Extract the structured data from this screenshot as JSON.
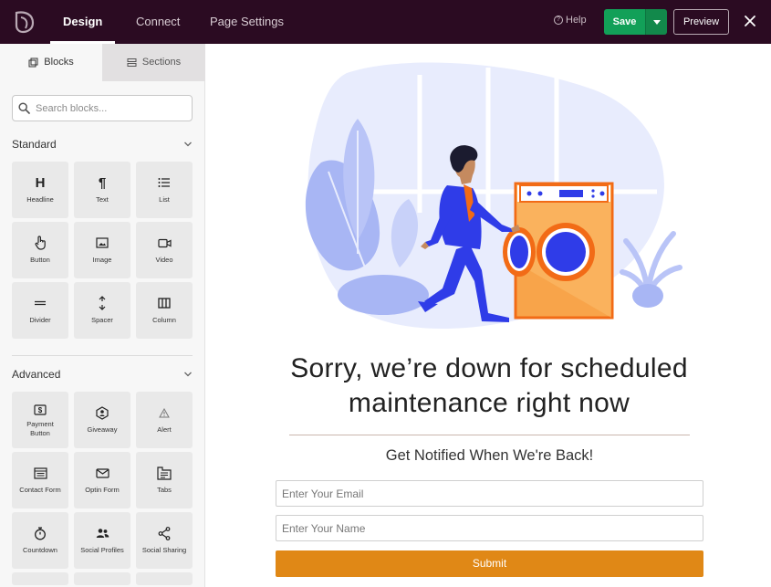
{
  "colors": {
    "topbar_bg": "#2b0b22",
    "save_green": "#12a058",
    "submit_orange": "#e08816",
    "illustration_blue": "#2f3ce8",
    "illustration_orange": "#f26b16",
    "illustration_pale_blue": "#e8ecfd"
  },
  "topbar": {
    "logo_icon": "leaf-logo-icon",
    "tabs": [
      {
        "label": "Design",
        "active": true
      },
      {
        "label": "Connect",
        "active": false
      },
      {
        "label": "Page Settings",
        "active": false
      }
    ],
    "help_label": "Help",
    "save_label": "Save",
    "preview_label": "Preview",
    "close_icon": "close-icon"
  },
  "sidebar": {
    "tabs": [
      {
        "label": "Blocks",
        "icon": "blocks-icon",
        "active": true
      },
      {
        "label": "Sections",
        "icon": "sections-icon",
        "active": false
      }
    ],
    "search_placeholder": "Search blocks...",
    "groups": [
      {
        "title": "Standard",
        "blocks": [
          {
            "label": "Headline",
            "icon": "headline-icon"
          },
          {
            "label": "Text",
            "icon": "paragraph-icon"
          },
          {
            "label": "List",
            "icon": "list-icon"
          },
          {
            "label": "Button",
            "icon": "hand-pointer-icon"
          },
          {
            "label": "Image",
            "icon": "image-icon"
          },
          {
            "label": "Video",
            "icon": "video-icon"
          },
          {
            "label": "Divider",
            "icon": "divider-icon"
          },
          {
            "label": "Spacer",
            "icon": "spacer-icon"
          },
          {
            "label": "Column",
            "icon": "column-icon"
          }
        ]
      },
      {
        "title": "Advanced",
        "blocks": [
          {
            "label": "Payment\nButton",
            "icon": "payment-icon"
          },
          {
            "label": "Giveaway",
            "icon": "giveaway-icon"
          },
          {
            "label": "Alert",
            "icon": "alert-icon"
          },
          {
            "label": "Contact Form",
            "icon": "contact-form-icon"
          },
          {
            "label": "Optin Form",
            "icon": "envelope-icon"
          },
          {
            "label": "Tabs",
            "icon": "tabs-icon"
          },
          {
            "label": "Countdown",
            "icon": "stopwatch-icon"
          },
          {
            "label": "Social Profiles",
            "icon": "users-icon"
          },
          {
            "label": "Social Sharing",
            "icon": "share-icon"
          }
        ]
      }
    ]
  },
  "page": {
    "headline_line1": "Sorry, we’re down for scheduled",
    "headline_line2": "maintenance right now",
    "subheadline": "Get Notified When We're Back!",
    "email_placeholder": "Enter Your Email",
    "name_placeholder": "Enter Your Name",
    "submit_label": "Submit"
  }
}
